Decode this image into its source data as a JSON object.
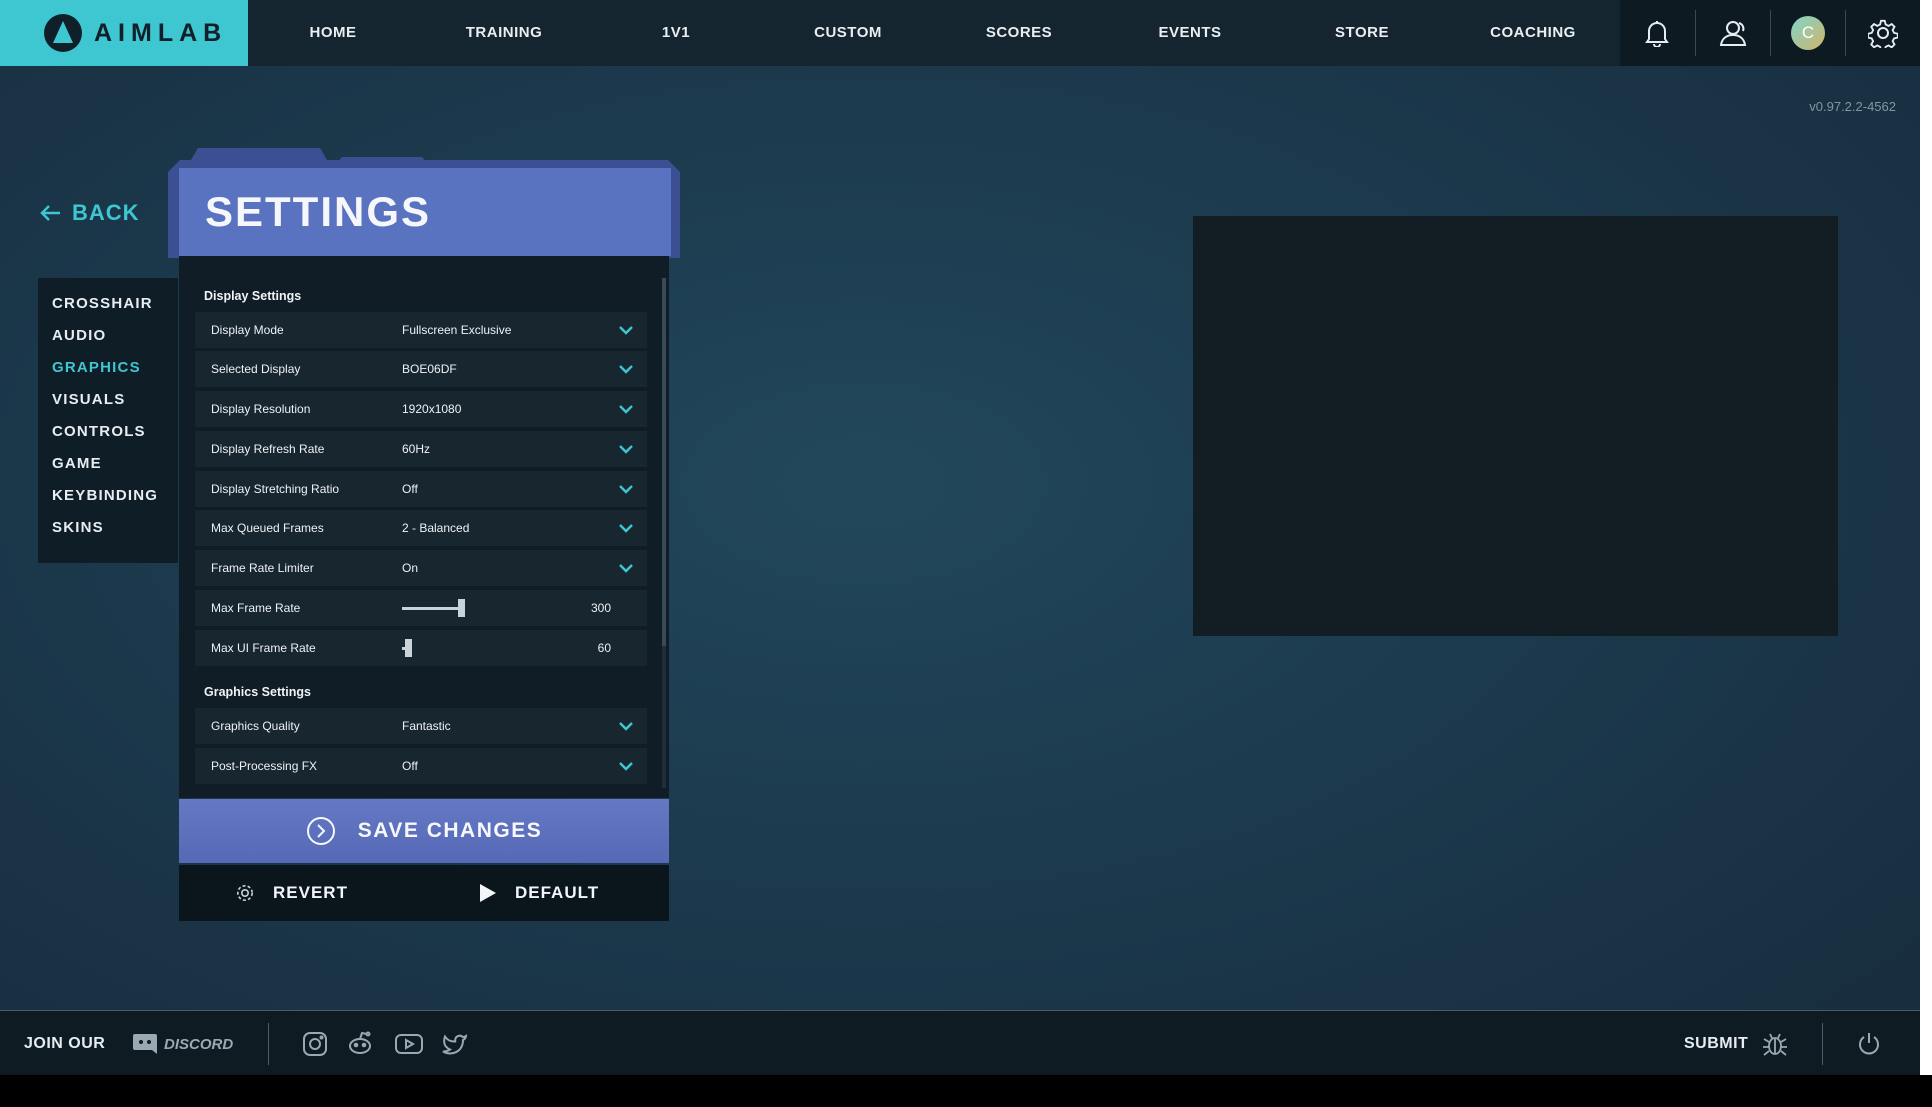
{
  "brand": {
    "name": "AIMLAB"
  },
  "nav": {
    "items": [
      "HOME",
      "TRAINING",
      "1V1",
      "CUSTOM",
      "SCORES",
      "EVENTS",
      "STORE",
      "COACHING"
    ],
    "icons": [
      "bell-icon",
      "friends-icon",
      "avatar",
      "gear-icon"
    ],
    "avatar_initial": "C"
  },
  "version": "v0.97.2.2-4562",
  "back_label": "BACK",
  "settings_menu": {
    "items": [
      "CROSSHAIR",
      "AUDIO",
      "GRAPHICS",
      "VISUALS",
      "CONTROLS",
      "GAME",
      "KEYBINDING",
      "SKINS"
    ],
    "active": "GRAPHICS"
  },
  "settings": {
    "title": "SETTINGS",
    "display_section": "Display Settings",
    "display_rows": [
      {
        "label": "Display Mode",
        "value": "Fullscreen Exclusive"
      },
      {
        "label": "Selected Display",
        "value": "BOE06DF"
      },
      {
        "label": "Display Resolution",
        "value": "1920x1080"
      },
      {
        "label": "Display Refresh Rate",
        "value": "60Hz"
      },
      {
        "label": "Display Stretching Ratio",
        "value": "Off"
      },
      {
        "label": "Max Queued Frames",
        "value": "2 - Balanced"
      },
      {
        "label": "Frame Rate Limiter",
        "value": "On"
      }
    ],
    "sliders": [
      {
        "label": "Max Frame Rate",
        "value": "300",
        "fill": 0.37
      },
      {
        "label": "Max UI Frame Rate",
        "value": "60",
        "fill": 0.02
      }
    ],
    "graphics_section": "Graphics Settings",
    "graphics_rows": [
      {
        "label": "Graphics Quality",
        "value": "Fantastic"
      },
      {
        "label": "Post-Processing FX",
        "value": "Off"
      }
    ]
  },
  "buttons": {
    "save": "SAVE CHANGES",
    "revert": "REVERT",
    "default": "DEFAULT"
  },
  "footer": {
    "join": "JOIN OUR",
    "discord": "DISCORD",
    "social_icons": [
      "instagram-icon",
      "reddit-icon",
      "youtube-icon",
      "twitter-icon"
    ],
    "submit": "SUBMIT"
  },
  "colors": {
    "accent": "#3ec6d1",
    "panel_header": "#5a73c0",
    "save_button": "#5e72bf",
    "background": "#1c3a4e"
  }
}
